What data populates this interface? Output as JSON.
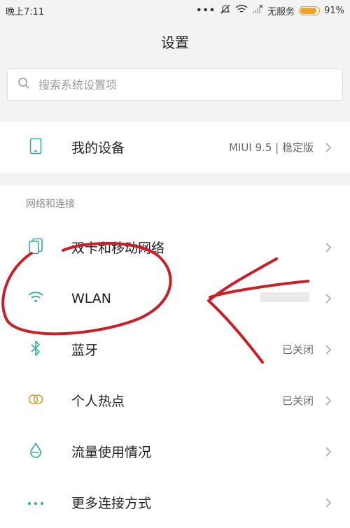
{
  "status_bar": {
    "time": "晚上7:11",
    "carrier": "无服务",
    "battery": "91%",
    "battery_level": 0.91
  },
  "header": {
    "title": "设置"
  },
  "search": {
    "placeholder": "搜索系统设置项"
  },
  "device": {
    "label": "我的设备",
    "value": "MIUI 9.5 | 稳定版"
  },
  "network_section": {
    "title": "网络和连接",
    "items": [
      {
        "label": "双卡和移动网络",
        "value": ""
      },
      {
        "label": "WLAN",
        "value": ""
      },
      {
        "label": "蓝牙",
        "value": "已关闭"
      },
      {
        "label": "个人热点",
        "value": "已关闭"
      },
      {
        "label": "流量使用情况",
        "value": ""
      },
      {
        "label": "更多连接方式",
        "value": ""
      }
    ]
  },
  "colors": {
    "icon_teal": "#3aa99f",
    "hotspot_gold": "#d8a24a",
    "annotation_red": "#c8202a",
    "battery_orange": "#f0a418"
  }
}
